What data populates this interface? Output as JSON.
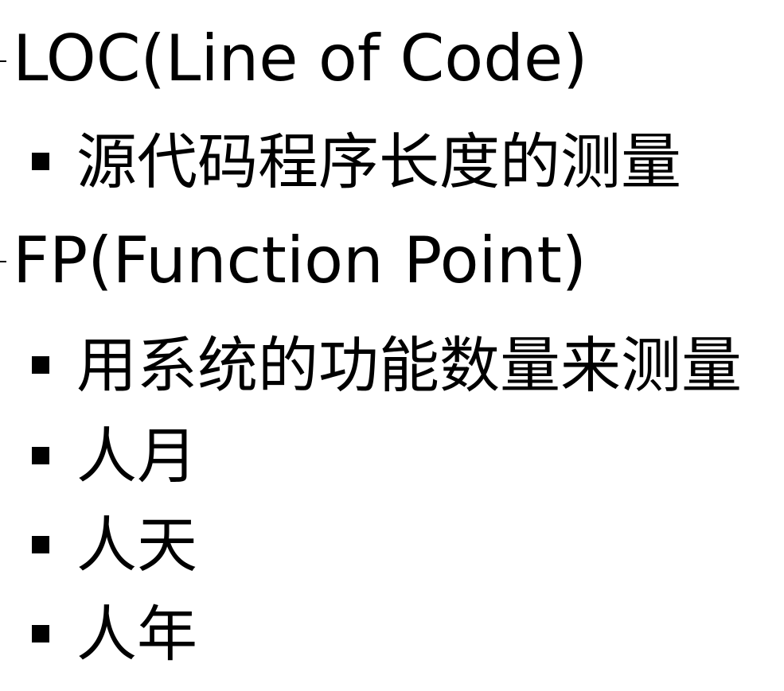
{
  "items": [
    {
      "label": "LOC(Line of Code)",
      "children": [
        "源代码程序长度的测量"
      ]
    },
    {
      "label": "FP(Function Point)",
      "children": [
        "用系统的功能数量来测量",
        "人月",
        "人天",
        "人年"
      ]
    }
  ]
}
